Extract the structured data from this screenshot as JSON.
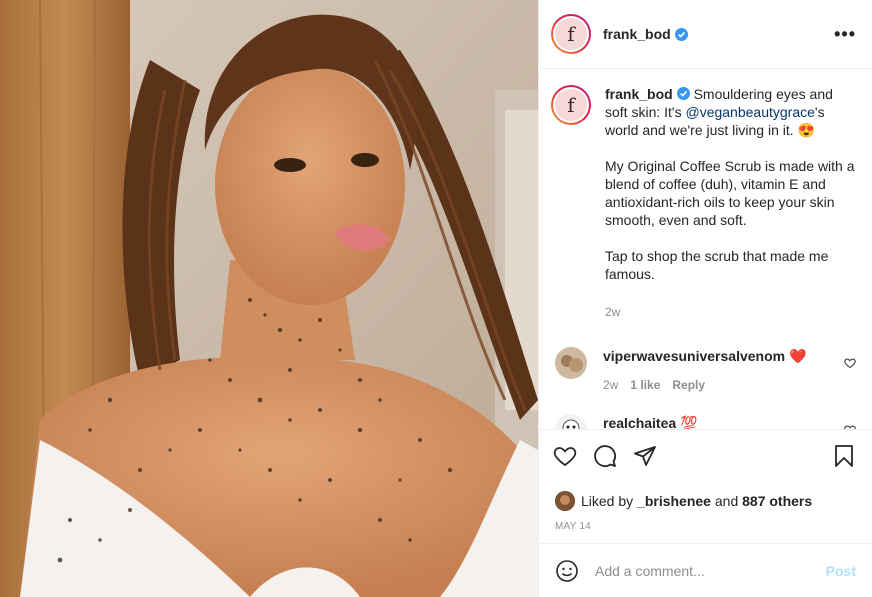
{
  "account": {
    "username": "frank_bod",
    "avatar_letter": "f"
  },
  "caption": {
    "username": "frank_bod",
    "line1_pre": " Smouldering eyes and soft skin: It's ",
    "mention": "@veganbeautygrace",
    "line1_post": "'s world and we're just living in it. 😍",
    "paragraph2": "My Original Coffee Scrub is made with a blend of coffee (duh), vitamin E and antioxidant-rich oils to keep your skin smooth, even and soft.",
    "paragraph3": "Tap to shop the scrub that made me famous.",
    "time": "2w"
  },
  "comments": [
    {
      "username": "viperwavesuniversalvenom",
      "text": " ❤️",
      "time": "2w",
      "likes": "1 like",
      "reply": "Reply"
    },
    {
      "username": "realchaitea",
      "text": " 💯"
    }
  ],
  "likes_line": {
    "prefix": "Liked by ",
    "user": "_brishenee",
    "middle": " and ",
    "count": "887 others"
  },
  "date": "MAY 14",
  "add_comment": {
    "placeholder": "Add a comment...",
    "post_label": "Post"
  },
  "colors": {
    "accent_link": "#00376b",
    "verified": "#3897f0",
    "post_disabled": "#b2dffc",
    "heart_red": "#ed4956"
  },
  "icons": {
    "verified": "verified-badge-icon",
    "more": "more-options-icon",
    "like": "heart-icon",
    "comment": "comment-bubble-icon",
    "share": "paper-plane-icon",
    "save": "bookmark-icon",
    "emoji": "smiley-icon",
    "comment_like": "small-heart-icon"
  }
}
